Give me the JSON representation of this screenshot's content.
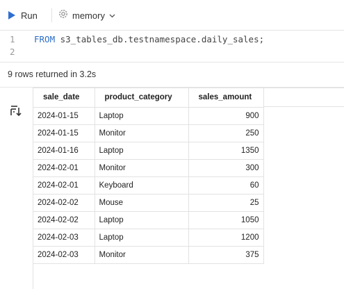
{
  "toolbar": {
    "run_label": "Run",
    "engine_label": "memory"
  },
  "editor": {
    "lines": [
      {
        "number": "1",
        "keyword": "FROM",
        "rest": " s3_tables_db.testnamespace.daily_sales;"
      },
      {
        "number": "2",
        "keyword": "",
        "rest": ""
      }
    ]
  },
  "status": {
    "text": "9 rows returned in 3.2s"
  },
  "results": {
    "columns": [
      "sale_date",
      "product_category",
      "sales_amount"
    ],
    "rows": [
      [
        "2024-01-15",
        "Laptop",
        "900"
      ],
      [
        "2024-01-15",
        "Monitor",
        "250"
      ],
      [
        "2024-01-16",
        "Laptop",
        "1350"
      ],
      [
        "2024-02-01",
        "Monitor",
        "300"
      ],
      [
        "2024-02-01",
        "Keyboard",
        "60"
      ],
      [
        "2024-02-02",
        "Mouse",
        "25"
      ],
      [
        "2024-02-02",
        "Laptop",
        "1050"
      ],
      [
        "2024-02-03",
        "Laptop",
        "1200"
      ],
      [
        "2024-02-03",
        "Monitor",
        "375"
      ]
    ]
  },
  "colors": {
    "run_icon": "#2f6fd1",
    "keyword": "#2d6ec7",
    "border": "#e2e2e2"
  },
  "icons": {
    "run": "play-icon",
    "engine": "engine-gear-icon",
    "engine_dropdown": "chevron-down-icon",
    "rail": "filter-sort-icon"
  }
}
